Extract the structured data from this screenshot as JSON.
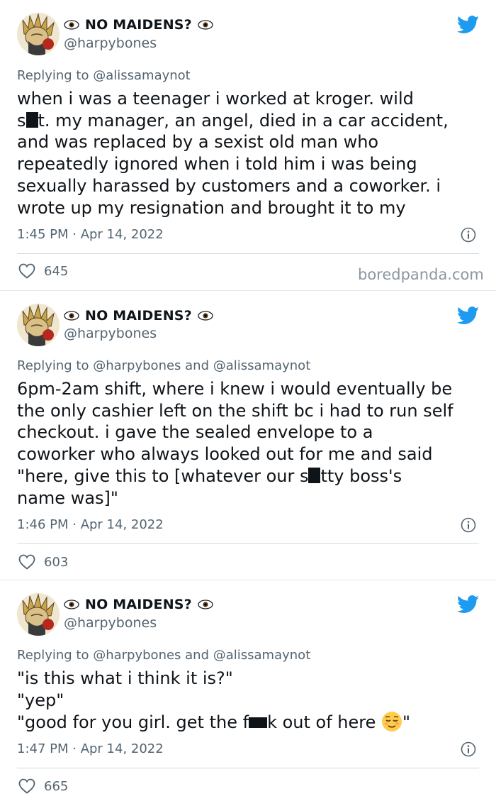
{
  "tweets": [
    {
      "display_name": "NO MAIDENS?",
      "handle": "@harpybones",
      "reply_prefix": "Replying to",
      "reply_to": "@alissamaynot",
      "body_before": "when i was a teenager i worked at kroger. wild\ns",
      "body_after": "t. my manager, an angel, died in a car accident,\nand was replaced by a sexist old man who\nrepeatedly ignored when i told him i was being\nsexually harassed by customers and a coworker. i\nwrote up my resignation and brought it to my",
      "timestamp": "1:45 PM · Apr 14, 2022",
      "likes": "645"
    },
    {
      "display_name": "NO MAIDENS?",
      "handle": "@harpybones",
      "reply_prefix": "Replying to",
      "reply_to": "@harpybones and @alissamaynot",
      "body_before": "6pm-2am shift, where i knew i would eventually be\nthe only cashier left on the shift bc i had to run self\ncheckout. i gave the sealed envelope to a\ncoworker who always looked out for me and said\n\"here, give this to [whatever our s",
      "body_after": "tty boss's\nname was]\"",
      "timestamp": "1:46 PM · Apr 14, 2022",
      "likes": "603"
    },
    {
      "display_name": "NO MAIDENS?",
      "handle": "@harpybones",
      "reply_prefix": "Replying to",
      "reply_to": "@harpybones and @alissamaynot",
      "body_before": "\"is this what i think it is?\"\n\"yep\"\n\"good for you girl. get the f",
      "body_after": "k out of here ",
      "body_end": "\"",
      "timestamp": "1:47 PM · Apr 14, 2022",
      "likes": "665"
    }
  ],
  "watermark": "boredpanda.com",
  "icons": {
    "eye": "eye-icon",
    "bird": "twitter-bird-icon",
    "info": "info-icon",
    "heart": "heart-icon",
    "emoji": "relieved-face-emoji",
    "redaction": "redaction-block"
  },
  "colors": {
    "twitter_blue": "#1d9bf0",
    "text": "#0f1419",
    "muted": "#536471",
    "divider": "#cfd9de"
  }
}
